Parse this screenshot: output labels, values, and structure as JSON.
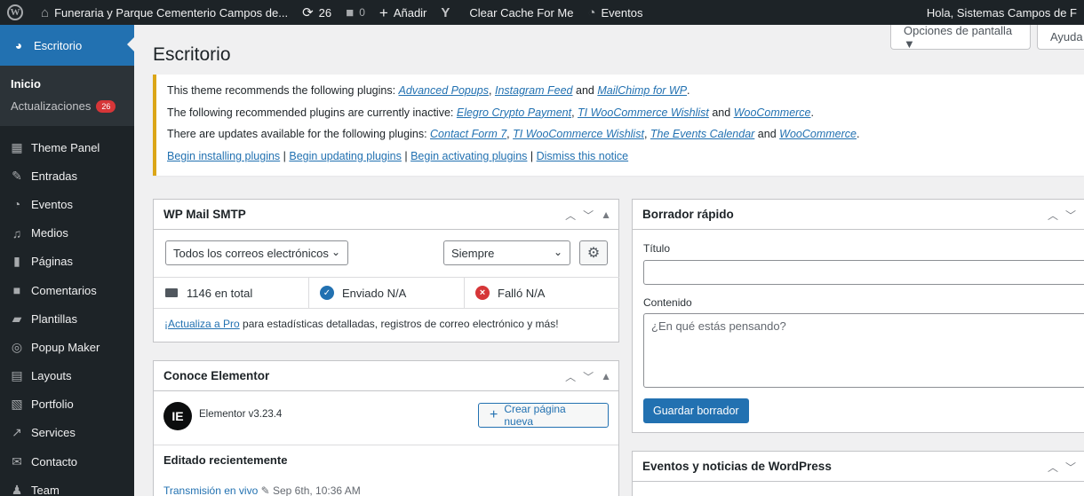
{
  "adminbar": {
    "wp_logo": "W",
    "site_name": "Funeraria y Parque Cementerio Campos de...",
    "updates_count": "26",
    "comments_count": "0",
    "add_new": "Añadir",
    "clear_cache": "Clear Cache For Me",
    "events": "Eventos",
    "howdy": "Hola, Sistemas Campos de F"
  },
  "sidebar": {
    "current": "Escritorio",
    "submenu": [
      {
        "label": "Inicio"
      },
      {
        "label": "Actualizaciones",
        "badge": "26"
      }
    ],
    "items": [
      {
        "label": "Theme Panel",
        "icon": "grid-icon"
      },
      {
        "label": "Entradas",
        "icon": "pin-icon"
      },
      {
        "label": "Eventos",
        "icon": "calendar-icon"
      },
      {
        "label": "Medios",
        "icon": "media-icon"
      },
      {
        "label": "Páginas",
        "icon": "page-icon"
      },
      {
        "label": "Comentarios",
        "icon": "comment-icon"
      },
      {
        "label": "Plantillas",
        "icon": "folder-icon"
      },
      {
        "label": "Popup Maker",
        "icon": "popup-icon"
      },
      {
        "label": "Layouts",
        "icon": "layout-icon"
      },
      {
        "label": "Portfolio",
        "icon": "portfolio-icon"
      },
      {
        "label": "Services",
        "icon": "tool-icon"
      },
      {
        "label": "Contacto",
        "icon": "mail-icon"
      },
      {
        "label": "Team",
        "icon": "user-icon"
      }
    ]
  },
  "screen_options": "Opciones de pantalla ▼",
  "help": "Ayuda",
  "page_title": "Escritorio",
  "notice": {
    "line1_prefix": "This theme recommends the following plugins: ",
    "line1_links": [
      "Advanced Popups",
      "Instagram Feed",
      "MailChimp for WP"
    ],
    "line2_prefix": "The following recommended plugins are currently inactive: ",
    "line2_links": [
      "Elegro Crypto Payment",
      "TI WooCommerce Wishlist",
      "WooCommerce"
    ],
    "line3_prefix": "There are updates available for the following plugins: ",
    "line3_links": [
      "Contact Form 7",
      "TI WooCommerce Wishlist",
      "The Events Calendar",
      "WooCommerce"
    ],
    "comma": ", ",
    "and": " and ",
    "period": ".",
    "sep": " | ",
    "actions": [
      "Begin installing plugins",
      "Begin updating plugins",
      "Begin activating plugins",
      "Dismiss this notice"
    ]
  },
  "smtp": {
    "title": "WP Mail SMTP",
    "filter_all": "Todos los correos electrónicos",
    "filter_time": "Siempre",
    "total": "1146 en total",
    "sent": "Enviado N/A",
    "failed": "Falló N/A",
    "upgrade_link": "¡Actualiza a Pro",
    "upgrade_rest": " para estadísticas detalladas, registros de correo electrónico y más!"
  },
  "elementor": {
    "title": "Conoce Elementor",
    "logo": "IE",
    "version": "Elementor v3.23.4",
    "create_button": "Crear página nueva",
    "recent_heading": "Editado recientemente",
    "recent_item": "Transmisión en vivo",
    "recent_meta": "Sep 6th, 10:36 AM"
  },
  "quick_draft": {
    "title": "Borrador rápido",
    "title_label": "Título",
    "content_label": "Contenido",
    "content_placeholder": "¿En qué estás pensando?",
    "save_button": "Guardar borrador"
  },
  "events_news": {
    "title": "Eventos y noticias de WordPress"
  }
}
